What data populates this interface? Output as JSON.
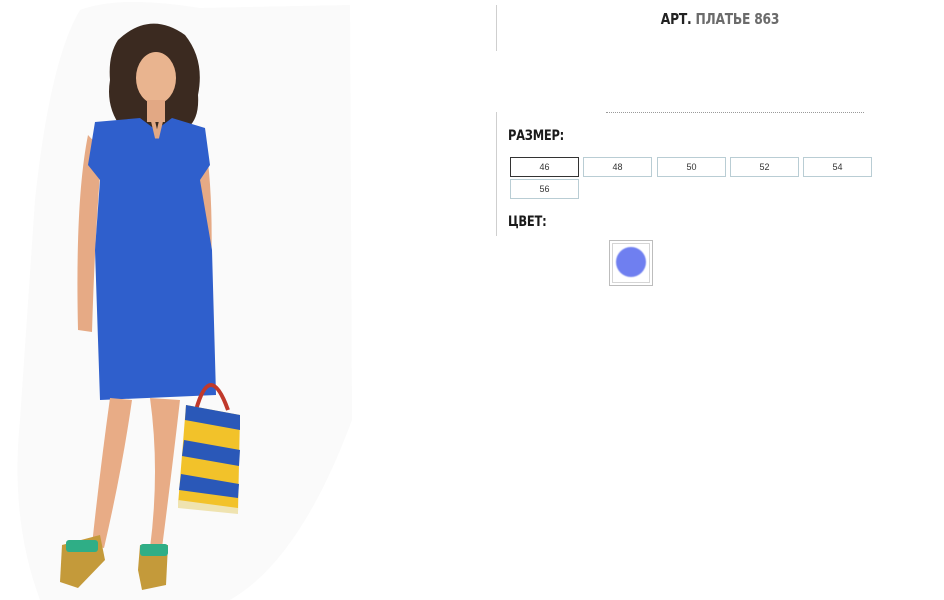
{
  "product": {
    "title_prefix": "АРТ.",
    "title_name": "ПЛАТЬЕ 863"
  },
  "size": {
    "label": "РАЗМЕР:",
    "options": [
      "46",
      "48",
      "50",
      "52",
      "54",
      "56"
    ],
    "selected": "46"
  },
  "color": {
    "label": "ЦВЕТ:",
    "swatch": "#6f7ff0"
  },
  "photo": {
    "dress_color": "#2f5fcc",
    "bag_stripe_1": "#2a58b8",
    "bag_stripe_2": "#f2c22a"
  }
}
